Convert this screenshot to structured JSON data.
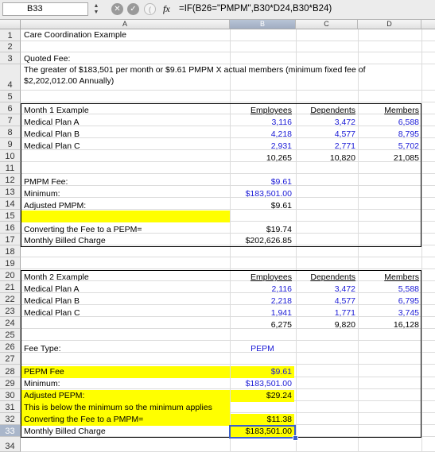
{
  "formula_bar": {
    "name_box": "B33",
    "fx_label": "fx",
    "formula": "=IF(B26=\"PMPM\",B30*D24,B30*B24)",
    "cancel_icon": "cancel-icon",
    "confirm_icon": "confirm-icon"
  },
  "columns": [
    "A",
    "B",
    "C",
    "D"
  ],
  "rows": [
    "1",
    "2",
    "3",
    "4",
    "5",
    "6",
    "7",
    "8",
    "9",
    "10",
    "11",
    "12",
    "13",
    "14",
    "15",
    "16",
    "17",
    "18",
    "19",
    "20",
    "21",
    "22",
    "23",
    "24",
    "25",
    "26",
    "27",
    "28",
    "29",
    "30",
    "31",
    "32",
    "33",
    "34"
  ],
  "cells": {
    "a1": "Care Coordination Example",
    "a3_line1": "Quoted Fee:",
    "a3_line2": "The greater of $183,501 per month or $9.61 PMPM X actual members (minimum fixed fee of",
    "a3_line3": "$2,202,012.00 Annually)",
    "m1": {
      "title": "Month 1 Example",
      "h_emp": "Employees",
      "h_dep": "Dependents",
      "h_mem": "Members",
      "rows": [
        {
          "label": "Medical Plan A",
          "emp": "3,116",
          "dep": "3,472",
          "mem": "6,588"
        },
        {
          "label": "Medical Plan B",
          "emp": "4,218",
          "dep": "4,577",
          "mem": "8,795"
        },
        {
          "label": "Medical Plan C",
          "emp": "2,931",
          "dep": "2,771",
          "mem": "5,702"
        }
      ],
      "total": {
        "emp": "10,265",
        "dep": "10,820",
        "mem": "21,085"
      }
    },
    "a12": "PMPM Fee:",
    "b12": "$9.61",
    "a13": "Minimum:",
    "b13": "$183,501.00",
    "a14": "Adjusted PMPM:",
    "b14": "$9.61",
    "a16": "Converting the Fee to a PEPM=",
    "b16": "$19.74",
    "a17": "Monthly Billed Charge",
    "b17": "$202,626.85",
    "m2": {
      "title": "Month 2 Example",
      "h_emp": "Employees",
      "h_dep": "Dependents",
      "h_mem": "Members",
      "rows": [
        {
          "label": "Medical Plan A",
          "emp": "2,116",
          "dep": "3,472",
          "mem": "5,588"
        },
        {
          "label": "Medical Plan B",
          "emp": "2,218",
          "dep": "4,577",
          "mem": "6,795"
        },
        {
          "label": "Medical Plan C",
          "emp": "1,941",
          "dep": "1,771",
          "mem": "3,745"
        }
      ],
      "total": {
        "emp": "6,275",
        "dep": "9,820",
        "mem": "16,128"
      }
    },
    "a26": "Fee Type:",
    "b26": "PEPM",
    "a28": "PEPM Fee",
    "b28": "$9.61",
    "a29": "Minimum:",
    "b29": "$183,501.00",
    "a30": "Adjusted PEPM:",
    "b30": "$29.24",
    "a31": "This is below the minimum so the minimum applies",
    "a32": "Converting the Fee to a PMPM=",
    "b32": "$11.38",
    "a33": "Monthly Billed Charge",
    "b33": "$183,501.00"
  },
  "colors": {
    "highlight": "#ffff00",
    "value_blue": "#1a1ad6",
    "selection": "#3a5fcd"
  }
}
